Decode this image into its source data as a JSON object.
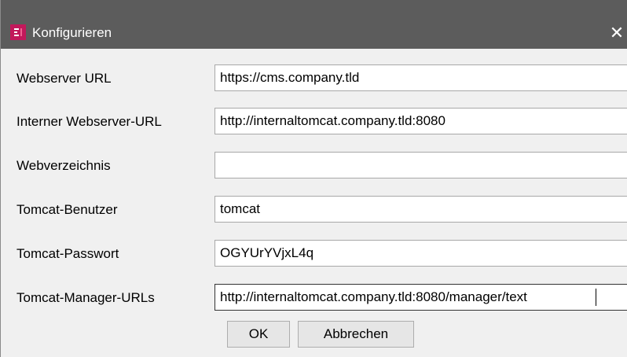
{
  "window": {
    "title": "Konfigurieren",
    "close_glyph": "✕",
    "icon": "app-logo-icon",
    "icon_color": "#c2185b"
  },
  "form": {
    "fields": [
      {
        "label": "Webserver URL",
        "value": "https://cms.company.tld"
      },
      {
        "label": "Interner Webserver-URL",
        "value": "http://internaltomcat.company.tld:8080"
      },
      {
        "label": "Webverzeichnis",
        "value": ""
      },
      {
        "label": "Tomcat-Benutzer",
        "value": "tomcat"
      },
      {
        "label": "Tomcat-Passwort",
        "value": "OGYUrYVjxL4q"
      },
      {
        "label": "Tomcat-Manager-URLs",
        "value": "http://internaltomcat.company.tld:8080/manager/text"
      }
    ]
  },
  "buttons": {
    "ok_label": "OK",
    "cancel_label": "Abbrechen"
  },
  "colors": {
    "titlebar": "#5c5c5c",
    "dialog_background": "#f0f0f0"
  }
}
